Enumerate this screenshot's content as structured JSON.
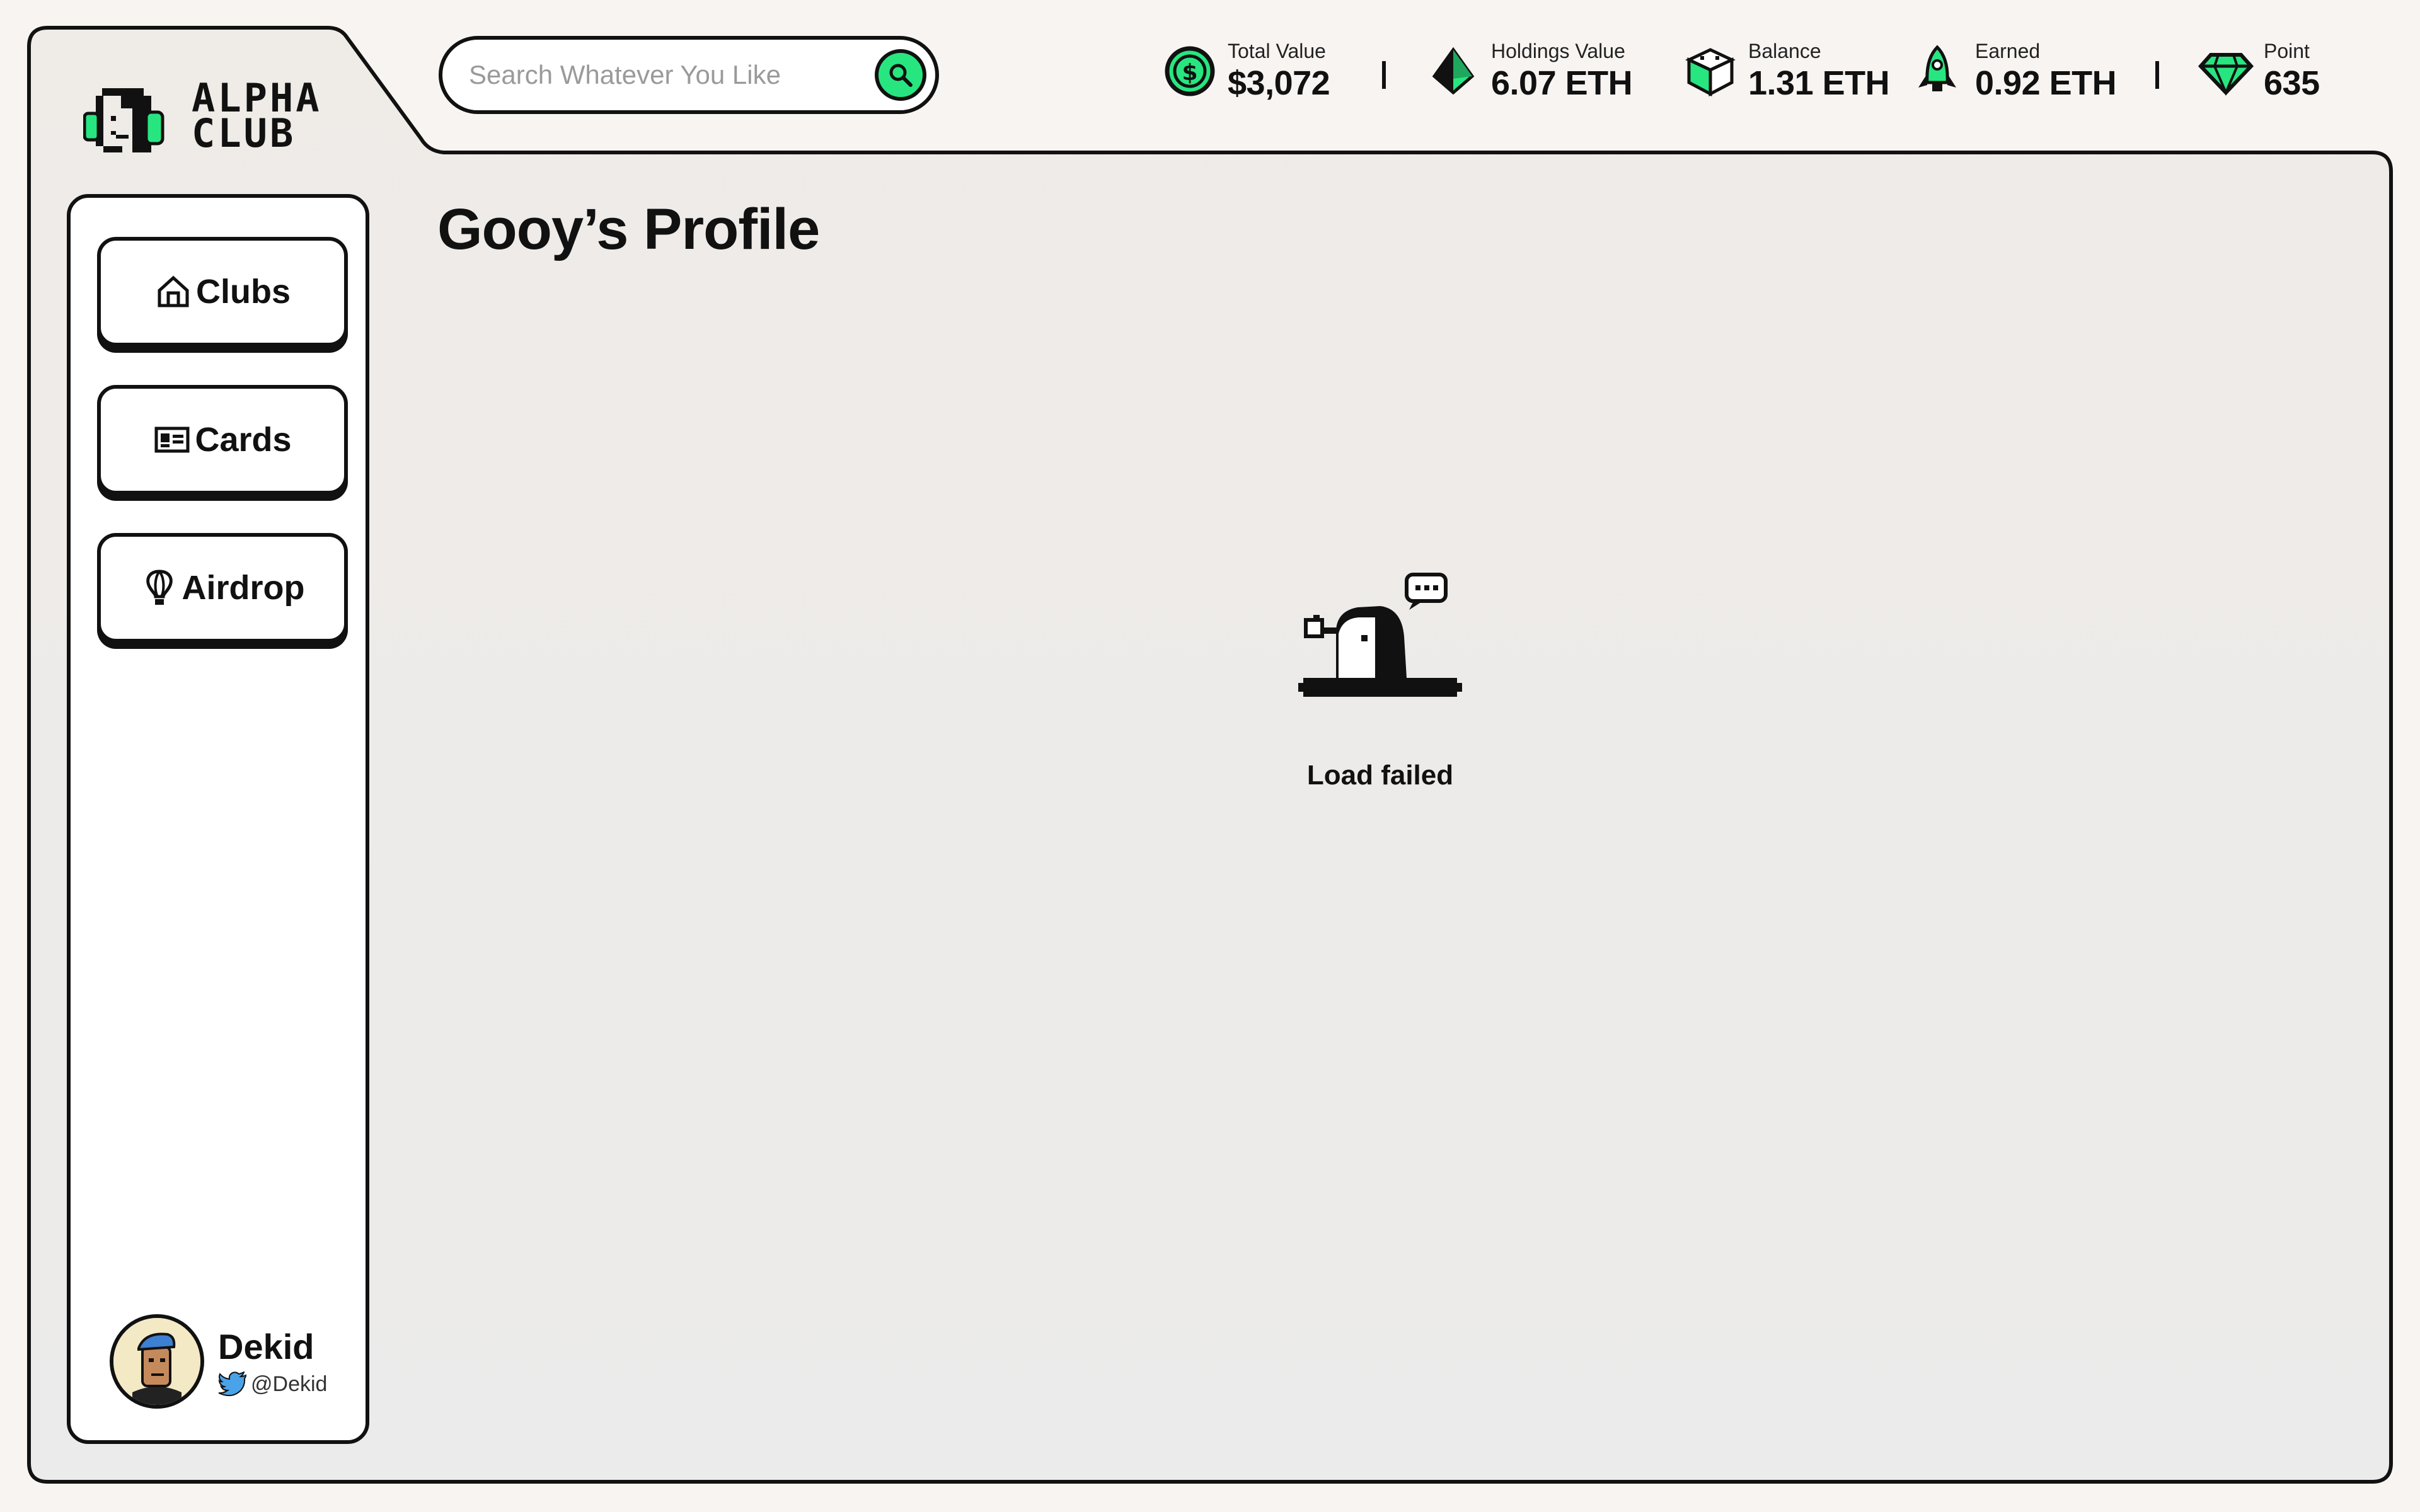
{
  "brand": {
    "logo_line1": "ALPHA",
    "logo_line2": "CLUB",
    "accent_color": "#27e680"
  },
  "search": {
    "placeholder": "Search Whatever You Like",
    "button_icon": "search-icon"
  },
  "stats": [
    {
      "label": "Total Value",
      "value": "$3,072",
      "icon": "dollar-coin-icon"
    },
    {
      "label": "Holdings Value",
      "value": "6.07 ETH",
      "icon": "ethereum-icon"
    },
    {
      "label": "Balance",
      "value": "1.31 ETH",
      "icon": "cube-icon"
    },
    {
      "label": "Earned",
      "value": "0.92 ETH",
      "icon": "rocket-icon"
    },
    {
      "label": "Point",
      "value": "635",
      "icon": "diamond-icon"
    }
  ],
  "sidebar": {
    "items": [
      {
        "label": "Clubs",
        "icon": "home-icon"
      },
      {
        "label": "Cards",
        "icon": "id-card-icon"
      },
      {
        "label": "Airdrop",
        "icon": "balloon-icon"
      }
    ],
    "user": {
      "name": "Dekid",
      "handle": "@Dekid",
      "handle_icon": "twitter-icon"
    }
  },
  "main": {
    "title": "Gooy’s Profile",
    "status_text": "Load failed",
    "status_icon": "penguin-error-icon"
  }
}
